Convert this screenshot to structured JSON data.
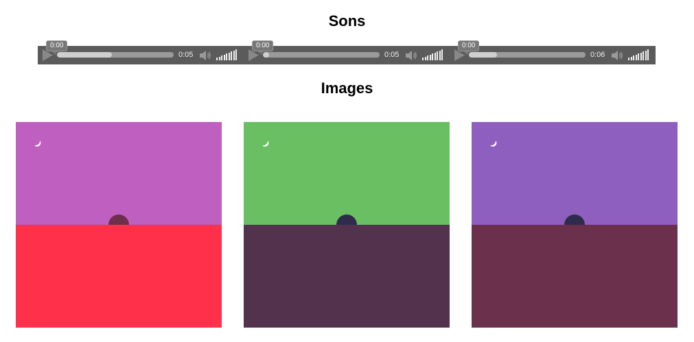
{
  "sounds_section": {
    "title": "Sons"
  },
  "images_section": {
    "title": "Images"
  },
  "players": [
    {
      "current_time": "0:00",
      "duration": "0:05",
      "buffered_fraction": 0.47,
      "volume_fraction": 1.0
    },
    {
      "current_time": "0:00",
      "duration": "0:05",
      "buffered_fraction": 0.05,
      "volume_fraction": 1.0
    },
    {
      "current_time": "0:00",
      "duration": "0:06",
      "buffered_fraction": 0.24,
      "volume_fraction": 1.0
    }
  ],
  "icons": {
    "play": "play-icon",
    "mute": "speaker-icon",
    "moon": "crescent-moon-icon",
    "sun": "half-circle-icon"
  },
  "scenes": [
    {
      "sky": "#bf5fbf",
      "ground": "#ff304a",
      "sun": "#6e2f4c",
      "moon": "#ffffff"
    },
    {
      "sky": "#6abf62",
      "ground": "#52324c",
      "sun": "#2f2b4c",
      "moon": "#ffffff"
    },
    {
      "sky": "#8f5fbf",
      "ground": "#6a304c",
      "sun": "#2f2b4c",
      "moon": "#ffffff"
    }
  ],
  "colors": {
    "player_bg": "#5b5b5b",
    "track_bg": "#9a9a9a",
    "track_loaded": "#cfcfcf"
  }
}
